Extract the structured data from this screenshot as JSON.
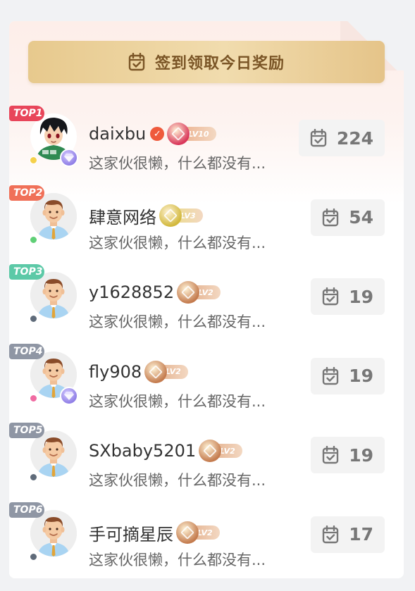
{
  "sign_button": {
    "label": "签到领取今日奖励",
    "icon": "calendar-check-icon"
  },
  "users": [
    {
      "rank": "TOP1",
      "rank_color": "#e8465a",
      "name": "daixbu",
      "verified": true,
      "level": "LV10",
      "level_color": "#eaa67f",
      "medal_color": "#d9365a",
      "status_color": "#f5d04a",
      "vip": true,
      "avatar": "cartoon-boy",
      "bio": "这家伙很懒，什么都没有...",
      "sign_days": "224"
    },
    {
      "rank": "TOP2",
      "rank_color": "#f07058",
      "name": "肆意网络",
      "verified": false,
      "level": "LV3",
      "level_color": "#e8dc78",
      "medal_color": "#d2b83c",
      "status_color": "#5fcf76",
      "vip": false,
      "avatar": "default-man",
      "bio": "这家伙很懒，什么都没有...",
      "sign_days": "54"
    },
    {
      "rank": "TOP3",
      "rank_color": "#5cc9a7",
      "name": "y1628852",
      "verified": false,
      "level": "LV2",
      "level_color": "#dfa47d",
      "medal_color": "#c47b4e",
      "status_color": "#5f6b7a",
      "vip": false,
      "avatar": "default-man",
      "bio": "这家伙很懒，什么都没有...",
      "sign_days": "19"
    },
    {
      "rank": "TOP4",
      "rank_color": "#8f96a4",
      "name": "fly908",
      "verified": false,
      "level": "LV2",
      "level_color": "#dfa47d",
      "medal_color": "#c47b4e",
      "status_color": "#f06ba2",
      "vip": true,
      "avatar": "default-man",
      "bio": "这家伙很懒，什么都没有...",
      "sign_days": "19"
    },
    {
      "rank": "TOP5",
      "rank_color": "#8f96a4",
      "name": "SXbaby5201",
      "verified": false,
      "level": "LV2",
      "level_color": "#dfa47d",
      "medal_color": "#c47b4e",
      "status_color": "#5f6b7a",
      "vip": false,
      "avatar": "default-man",
      "bio": "这家伙很懒，什么都没有...",
      "sign_days": "19"
    },
    {
      "rank": "TOP6",
      "rank_color": "#8f96a4",
      "name": "手可摘星辰",
      "verified": false,
      "level": "LV2",
      "level_color": "#dfa47d",
      "medal_color": "#c47b4e",
      "status_color": "#5f6b7a",
      "vip": false,
      "avatar": "default-man",
      "bio": "这家伙很懒，什么都没有...",
      "sign_days": "17"
    }
  ]
}
